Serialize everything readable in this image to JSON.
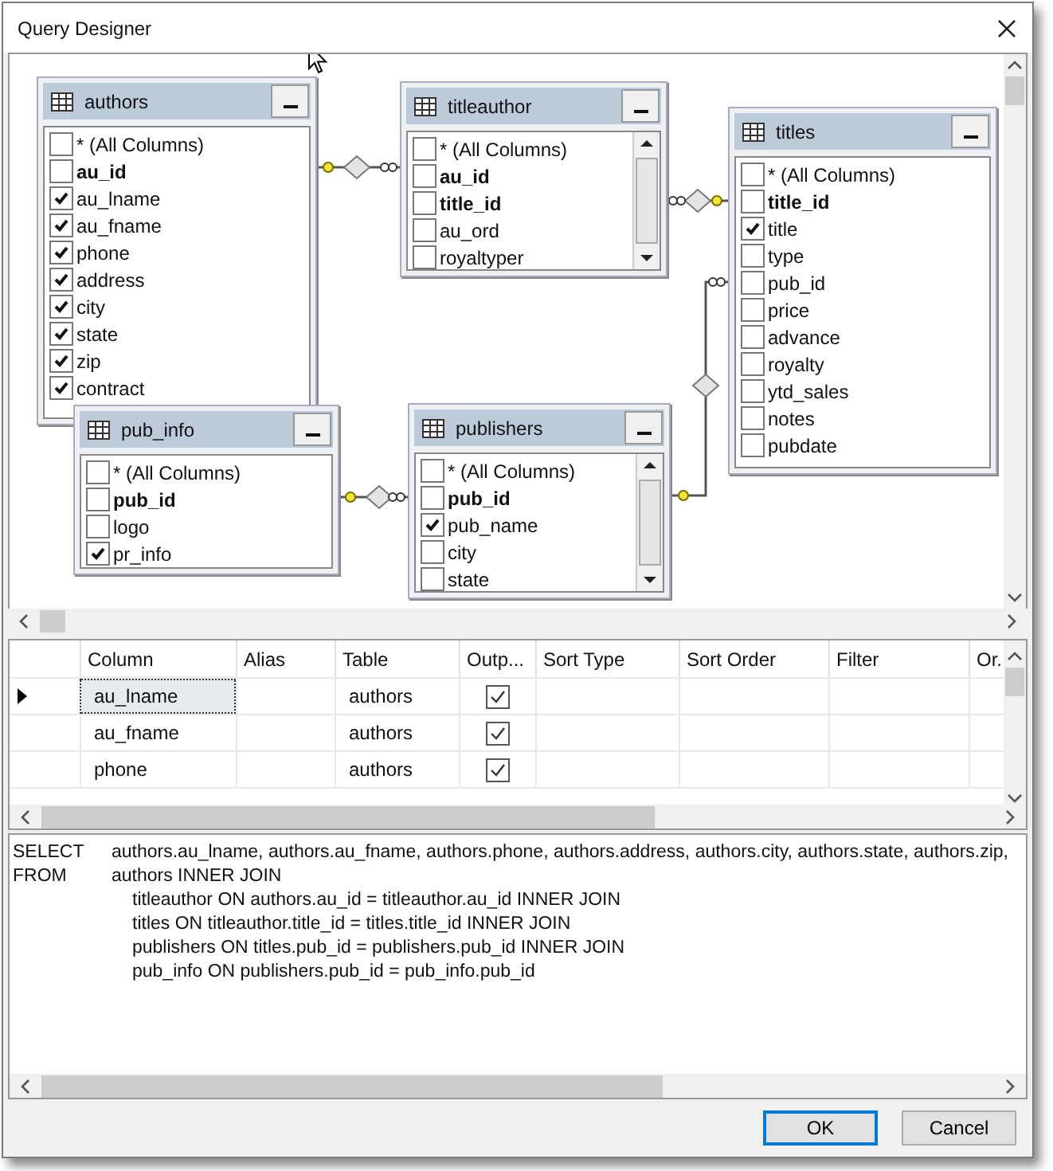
{
  "window": {
    "title": "Query Designer"
  },
  "diagram": {
    "tables": [
      {
        "name": "authors",
        "columns": [
          {
            "name": "* (All Columns)",
            "key": false,
            "checked": false
          },
          {
            "name": "au_id",
            "key": true,
            "checked": false
          },
          {
            "name": "au_lname",
            "key": false,
            "checked": true
          },
          {
            "name": "au_fname",
            "key": false,
            "checked": true
          },
          {
            "name": "phone",
            "key": false,
            "checked": true
          },
          {
            "name": "address",
            "key": false,
            "checked": true
          },
          {
            "name": "city",
            "key": false,
            "checked": true
          },
          {
            "name": "state",
            "key": false,
            "checked": true
          },
          {
            "name": "zip",
            "key": false,
            "checked": true
          },
          {
            "name": "contract",
            "key": false,
            "checked": true
          }
        ]
      },
      {
        "name": "titleauthor",
        "columns": [
          {
            "name": "* (All Columns)",
            "key": false,
            "checked": false
          },
          {
            "name": "au_id",
            "key": true,
            "checked": false
          },
          {
            "name": "title_id",
            "key": true,
            "checked": false
          },
          {
            "name": "au_ord",
            "key": false,
            "checked": false
          },
          {
            "name": "royaltyper",
            "key": false,
            "checked": false
          }
        ]
      },
      {
        "name": "titles",
        "columns": [
          {
            "name": "* (All Columns)",
            "key": false,
            "checked": false
          },
          {
            "name": "title_id",
            "key": true,
            "checked": false
          },
          {
            "name": "title",
            "key": false,
            "checked": true
          },
          {
            "name": "type",
            "key": false,
            "checked": false
          },
          {
            "name": "pub_id",
            "key": false,
            "checked": false
          },
          {
            "name": "price",
            "key": false,
            "checked": false
          },
          {
            "name": "advance",
            "key": false,
            "checked": false
          },
          {
            "name": "royalty",
            "key": false,
            "checked": false
          },
          {
            "name": "ytd_sales",
            "key": false,
            "checked": false
          },
          {
            "name": "notes",
            "key": false,
            "checked": false
          },
          {
            "name": "pubdate",
            "key": false,
            "checked": false
          }
        ]
      },
      {
        "name": "pub_info",
        "columns": [
          {
            "name": "* (All Columns)",
            "key": false,
            "checked": false
          },
          {
            "name": "pub_id",
            "key": true,
            "checked": false
          },
          {
            "name": "logo",
            "key": false,
            "checked": false
          },
          {
            "name": "pr_info",
            "key": false,
            "checked": true
          }
        ]
      },
      {
        "name": "publishers",
        "columns": [
          {
            "name": "* (All Columns)",
            "key": false,
            "checked": false
          },
          {
            "name": "pub_id",
            "key": true,
            "checked": false
          },
          {
            "name": "pub_name",
            "key": false,
            "checked": true
          },
          {
            "name": "city",
            "key": false,
            "checked": false
          },
          {
            "name": "state",
            "key": false,
            "checked": false
          }
        ]
      }
    ]
  },
  "grid": {
    "columns": [
      "Column",
      "Alias",
      "Table",
      "Outp...",
      "Sort Type",
      "Sort Order",
      "Filter",
      "Or."
    ],
    "rows": [
      {
        "column": "au_lname",
        "table": "authors",
        "output": true,
        "selected": true
      },
      {
        "column": "au_fname",
        "table": "authors",
        "output": true,
        "selected": false
      },
      {
        "column": "phone",
        "table": "authors",
        "output": true,
        "selected": false
      }
    ]
  },
  "sql": {
    "lines": [
      {
        "kind": "clause",
        "keyword": "SELECT",
        "text": "authors.au_lname, authors.au_fname, authors.phone, authors.address, authors.city, authors.state, authors.zip,"
      },
      {
        "kind": "clause",
        "keyword": "FROM",
        "text": "authors INNER JOIN"
      },
      {
        "kind": "continuation",
        "text": "titleauthor ON authors.au_id = titleauthor.au_id INNER JOIN"
      },
      {
        "kind": "continuation",
        "text": "titles ON titleauthor.title_id = titles.title_id INNER JOIN"
      },
      {
        "kind": "continuation",
        "text": "publishers ON titles.pub_id = publishers.pub_id INNER JOIN"
      },
      {
        "kind": "continuation",
        "text": "pub_info ON publishers.pub_id = pub_info.pub_id"
      }
    ]
  },
  "buttons": [
    {
      "label": "OK",
      "default": true
    },
    {
      "label": "Cancel",
      "default": false
    }
  ]
}
